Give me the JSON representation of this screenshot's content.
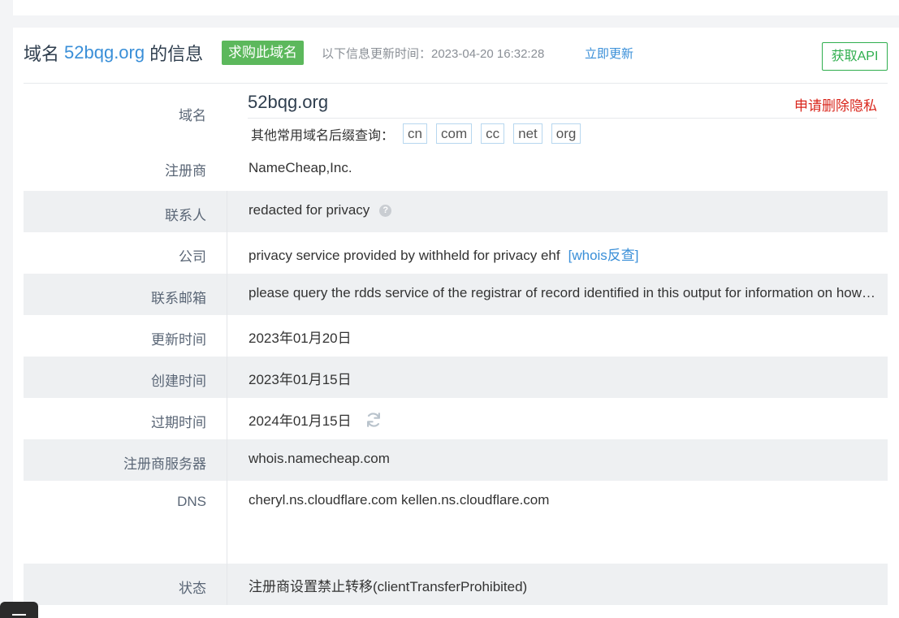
{
  "header": {
    "title_prefix": "域名",
    "domain": "52bqg.org",
    "title_suffix": "的信息",
    "buy_button": "求购此域名",
    "update_info": "以下信息更新时间：2023-04-20 16:32:28",
    "update_now": "立即更新",
    "api_button": "获取API"
  },
  "domain_row": {
    "label": "域名",
    "value": "52bqg.org",
    "delete_privacy": "申请删除隐私",
    "suffix_label": "其他常用域名后缀查询：",
    "suffixes": [
      "cn",
      "com",
      "cc",
      "net",
      "org"
    ]
  },
  "rows": {
    "registrar": {
      "label": "注册商",
      "value": "NameCheap,Inc."
    },
    "contact": {
      "label": "联系人",
      "value": "redacted for privacy",
      "help": "?"
    },
    "company": {
      "label": "公司",
      "value": "privacy service provided by withheld for privacy ehf",
      "link": "[whois反查]"
    },
    "email": {
      "label": "联系邮箱",
      "value": "please query the rdds service of the registrar of record identified in this output for information on how to contact the registrant"
    },
    "updated": {
      "label": "更新时间",
      "value": "2023年01月20日"
    },
    "created": {
      "label": "创建时间",
      "value": "2023年01月15日"
    },
    "expires": {
      "label": "过期时间",
      "value": "2024年01月15日"
    },
    "whois_server": {
      "label": "注册商服务器",
      "value": "whois.namecheap.com"
    },
    "dns": {
      "label": "DNS",
      "values": [
        "cheryl.ns.cloudflare.com",
        "kellen.ns.cloudflare.com"
      ]
    },
    "status": {
      "label": "状态",
      "value": "注册商设置禁止转移(clientTransferProhibited)"
    }
  },
  "colors": {
    "accent_blue": "#3a8fd8",
    "buy_green": "#5cb85c",
    "api_green": "#2fae4e",
    "privacy_red": "#d9261c"
  },
  "icons": [
    "help-icon",
    "refresh-icon",
    "menu-icon"
  ]
}
